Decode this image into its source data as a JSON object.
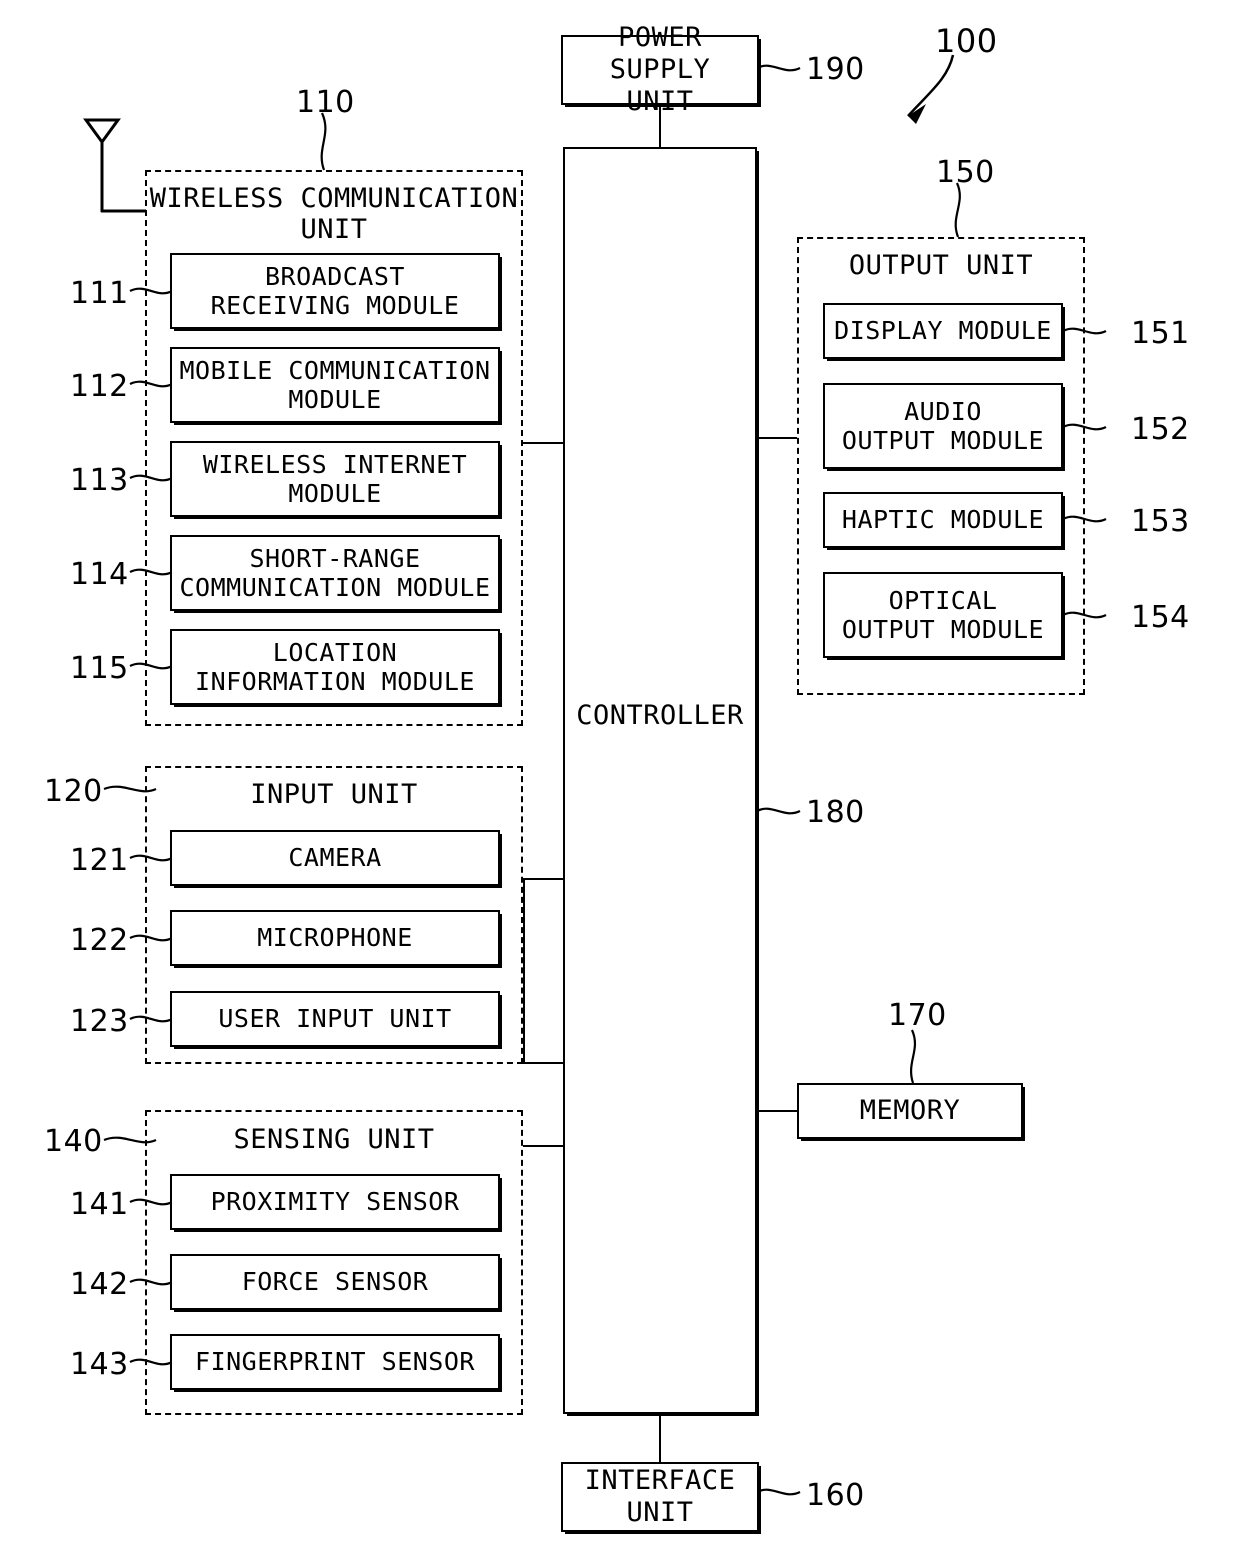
{
  "figure": {
    "system_ref": "100",
    "controller": {
      "label": "CONTROLLER",
      "ref": "180"
    },
    "power_supply": {
      "label": "POWER SUPPLY\nUNIT",
      "ref": "190"
    },
    "interface": {
      "label": "INTERFACE\nUNIT",
      "ref": "160"
    },
    "memory": {
      "label": "MEMORY",
      "ref": "170"
    },
    "antenna": "antenna-icon",
    "groups": [
      {
        "id": "wireless-communication-unit",
        "title": "WIRELESS COMMUNICATION\nUNIT",
        "ref": "110",
        "modules": [
          {
            "label": "BROADCAST\nRECEIVING MODULE",
            "ref": "111"
          },
          {
            "label": "MOBILE COMMUNICATION\nMODULE",
            "ref": "112"
          },
          {
            "label": "WIRELESS INTERNET\nMODULE",
            "ref": "113"
          },
          {
            "label": "SHORT-RANGE\nCOMMUNICATION MODULE",
            "ref": "114"
          },
          {
            "label": "LOCATION\nINFORMATION MODULE",
            "ref": "115"
          }
        ]
      },
      {
        "id": "input-unit",
        "title": "INPUT UNIT",
        "ref": "120",
        "modules": [
          {
            "label": "CAMERA",
            "ref": "121"
          },
          {
            "label": "MICROPHONE",
            "ref": "122"
          },
          {
            "label": "USER INPUT UNIT",
            "ref": "123"
          }
        ]
      },
      {
        "id": "sensing-unit",
        "title": "SENSING UNIT",
        "ref": "140",
        "modules": [
          {
            "label": "PROXIMITY SENSOR",
            "ref": "141"
          },
          {
            "label": "FORCE SENSOR",
            "ref": "142"
          },
          {
            "label": "FINGERPRINT SENSOR",
            "ref": "143"
          }
        ]
      },
      {
        "id": "output-unit",
        "title": "OUTPUT UNIT",
        "ref": "150",
        "modules": [
          {
            "label": "DISPLAY MODULE",
            "ref": "151"
          },
          {
            "label": "AUDIO\nOUTPUT MODULE",
            "ref": "152"
          },
          {
            "label": "HAPTIC MODULE",
            "ref": "153"
          },
          {
            "label": "OPTICAL\nOUTPUT MODULE",
            "ref": "154"
          }
        ]
      }
    ]
  },
  "colors": {
    "stroke": "#000000",
    "background": "#ffffff"
  }
}
